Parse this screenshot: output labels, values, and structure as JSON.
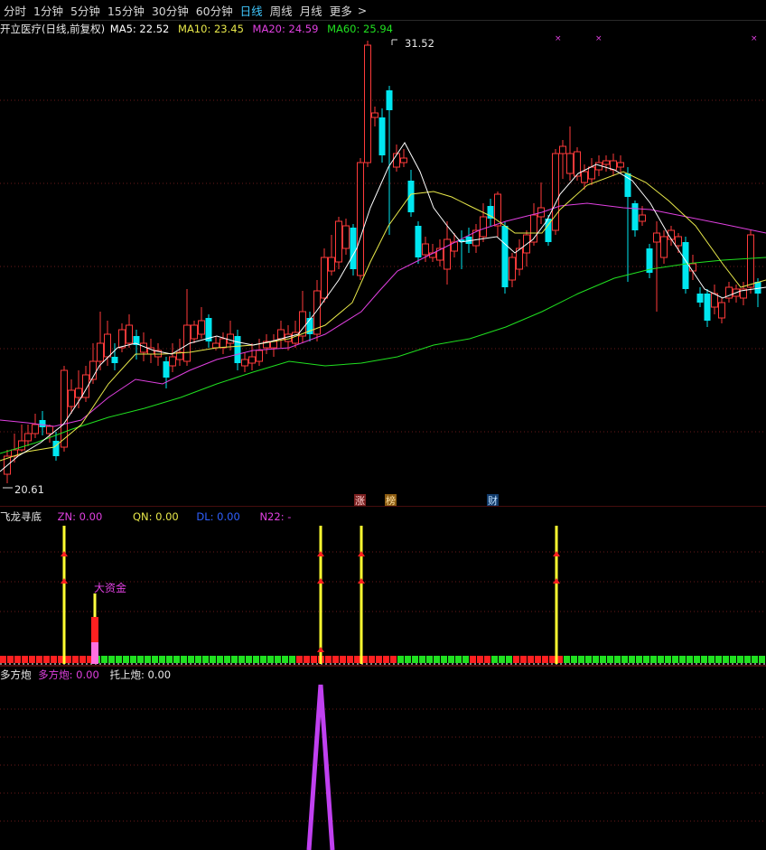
{
  "tabs": [
    {
      "label": "分时",
      "active": false
    },
    {
      "label": "1分钟",
      "active": false
    },
    {
      "label": "5分钟",
      "active": false
    },
    {
      "label": "15分钟",
      "active": false
    },
    {
      "label": "30分钟",
      "active": false
    },
    {
      "label": "60分钟",
      "active": false
    },
    {
      "label": "日线",
      "active": true
    },
    {
      "label": "周线",
      "active": false
    },
    {
      "label": "月线",
      "active": false
    },
    {
      "label": "更多",
      "active": false
    }
  ],
  "more_arrow": ">",
  "main": {
    "title": "开立医疗(日线,前复权)",
    "ma5": "MA5: 22.52",
    "ma10": "MA10: 23.45",
    "ma20": "MA20: 24.59",
    "ma60": "MA60: 25.94",
    "high_label": "31.52",
    "low_label": "20.61",
    "marker_zhang": "涨",
    "marker_bang": "榜",
    "marker_cai": "财",
    "colors": {
      "up": "#ff3a3a",
      "down": "#00e6f0",
      "ma5": "#ffffff",
      "ma10": "#e8e84a",
      "ma20": "#e040e0",
      "ma60": "#20e020"
    }
  },
  "indicator1": {
    "title": "飞龙寻底",
    "zn": "ZN: 0.00",
    "qn": "QN: 0.00",
    "dl": "DL: 0.00",
    "n22": "N22: -",
    "big_money_label": "大资金"
  },
  "indicator2": {
    "title": "多方炮",
    "dfp": "多方炮: 0.00",
    "tsp": "托上炮: 0.00"
  }
}
